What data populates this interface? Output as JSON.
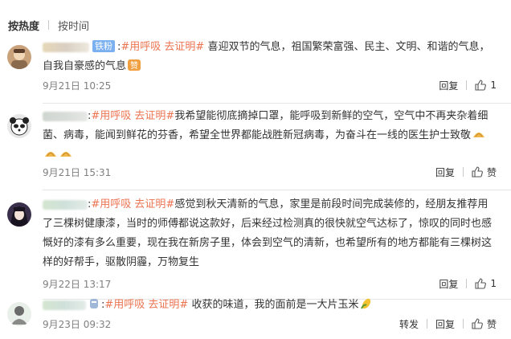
{
  "sort": {
    "hot_label": "按热度",
    "time_label": "按时间"
  },
  "comments": [
    {
      "fans_badge": "铁粉",
      "tag": "#用呼吸 去证明#",
      "text": " 喜迎双节的气息，祖国繁荣富强、民主、文明、和谐的气息，自我自豪感的气息",
      "time": "9月21日 10:25",
      "reply_label": "回复",
      "like_label": "1"
    },
    {
      "tag": "#用呼吸 去证明#",
      "text": "我希望能彻底摘掉口罩，能呼吸到新鲜的空气，空气中不再夹杂着细菌、病毒，能闻到鲜花的芬香，希望全世界都能战胜新冠病毒，为奋斗在一线的医生护士致敬",
      "time": "9月21日 15:31",
      "reply_label": "回复",
      "like_label": "赞"
    },
    {
      "tag": "#用呼吸 去证明#",
      "text": "感觉到秋天清新的气息，家里是前段时间完成装修的，经朋友推荐用了三棵树健康漆，当时的师傅都说这款好，后来经过检测真的很快就空气达标了，惊叹的同时也感慨好的漆有多么重要，现在我在新房子里，体会到空气的清新，也希望所有的地方都能有三棵树这样的好帮手，驱散阴霾，万物复生",
      "time": "9月22日 13:17",
      "reply_label": "回复",
      "like_label": "1"
    },
    {
      "tag": "#用呼吸 去证明#",
      "text": " 收获的味道，我的面前是一大片玉米",
      "time": "9月23日 09:32",
      "forward_label": "转发",
      "reply_label": "回复",
      "like_label": "赞"
    }
  ],
  "colors": {
    "tag": "#eb7350",
    "meta": "#808080",
    "fans_badge": "#7bb0f0"
  }
}
